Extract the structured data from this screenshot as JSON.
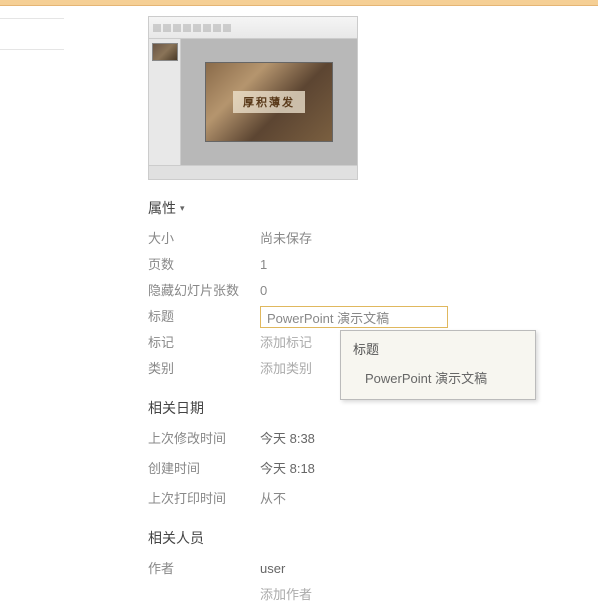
{
  "thumbnail": {
    "slide_text": "厚积薄发"
  },
  "sections": {
    "properties_header": "属性",
    "related_dates_header": "相关日期",
    "related_people_header": "相关人员"
  },
  "properties": {
    "size_label": "大小",
    "size_value": "尚未保存",
    "pages_label": "页数",
    "pages_value": "1",
    "hidden_slides_label": "隐藏幻灯片张数",
    "hidden_slides_value": "0",
    "title_label": "标题",
    "title_value": "PowerPoint 演示文稿",
    "tags_label": "标记",
    "tags_placeholder": "添加标记",
    "category_label": "类别",
    "category_placeholder": "添加类别"
  },
  "dates": {
    "modified_label": "上次修改时间",
    "modified_value": "今天 8:38",
    "created_label": "创建时间",
    "created_value": "今天 8:18",
    "printed_label": "上次打印时间",
    "printed_value": "从不"
  },
  "people": {
    "author_label": "作者",
    "author_value": "user",
    "add_author_placeholder": "添加作者"
  },
  "tooltip": {
    "title": "标题",
    "value": "PowerPoint 演示文稿"
  }
}
